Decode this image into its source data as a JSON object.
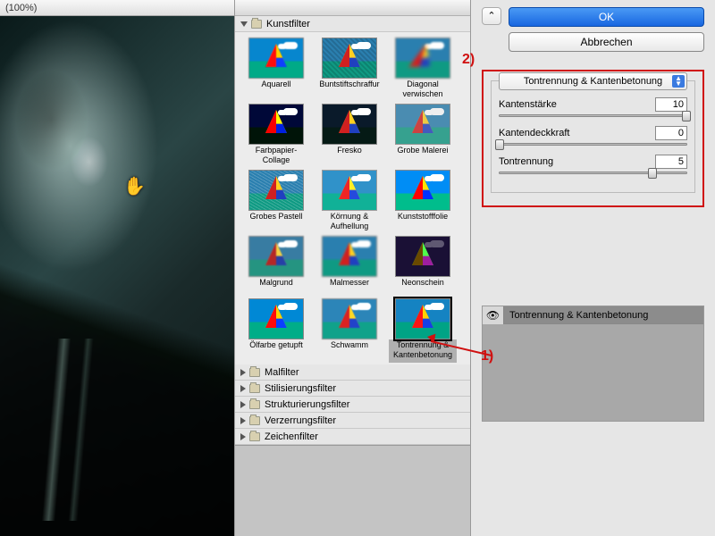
{
  "titlebar": "(100%)",
  "gallery": {
    "category_expanded": "Kunstfilter",
    "thumbs": [
      {
        "label": "Aquarell",
        "cls": "f-aquarell"
      },
      {
        "label": "Buntstiftschraffur",
        "cls": "f-bunt"
      },
      {
        "label": "Diagonal verwischen",
        "cls": "f-diag"
      },
      {
        "label": "Farbpapier-Collage",
        "cls": "f-farb"
      },
      {
        "label": "Fresko",
        "cls": "f-fresko"
      },
      {
        "label": "Grobe Malerei",
        "cls": "f-grob"
      },
      {
        "label": "Grobes Pastell",
        "cls": "f-pastell"
      },
      {
        "label": "Körnung & Aufhellung",
        "cls": "f-korn"
      },
      {
        "label": "Kunststofffolie",
        "cls": "f-kunst"
      },
      {
        "label": "Malgrund",
        "cls": "f-malg"
      },
      {
        "label": "Malmesser",
        "cls": "f-malm"
      },
      {
        "label": "Neonschein",
        "cls": "f-neon"
      },
      {
        "label": "Ölfarbe getupft",
        "cls": "f-oel"
      },
      {
        "label": "Schwamm",
        "cls": "f-schw"
      },
      {
        "label": "Tontrennung & Kantenbetonung",
        "cls": "f-tont",
        "selected": true
      }
    ],
    "categories_collapsed": [
      "Malfilter",
      "Stilisierungsfilter",
      "Strukturierungsfilter",
      "Verzerrungsfilter",
      "Zeichenfilter"
    ]
  },
  "buttons": {
    "ok": "OK",
    "cancel": "Abbrechen",
    "help": "⌃"
  },
  "filter_select": "Tontrennung & Kantenbetonung",
  "params": {
    "p1": {
      "label": "Kantenstärke",
      "value": "10",
      "pos": 100
    },
    "p2": {
      "label": "Kantendeckkraft",
      "value": "0",
      "pos": 0
    },
    "p3": {
      "label": "Tontrennung",
      "value": "5",
      "pos": 82
    }
  },
  "layer": {
    "name": "Tontrennung & Kantenbetonung"
  },
  "annotations": {
    "a1": "1)",
    "a2": "2)"
  }
}
